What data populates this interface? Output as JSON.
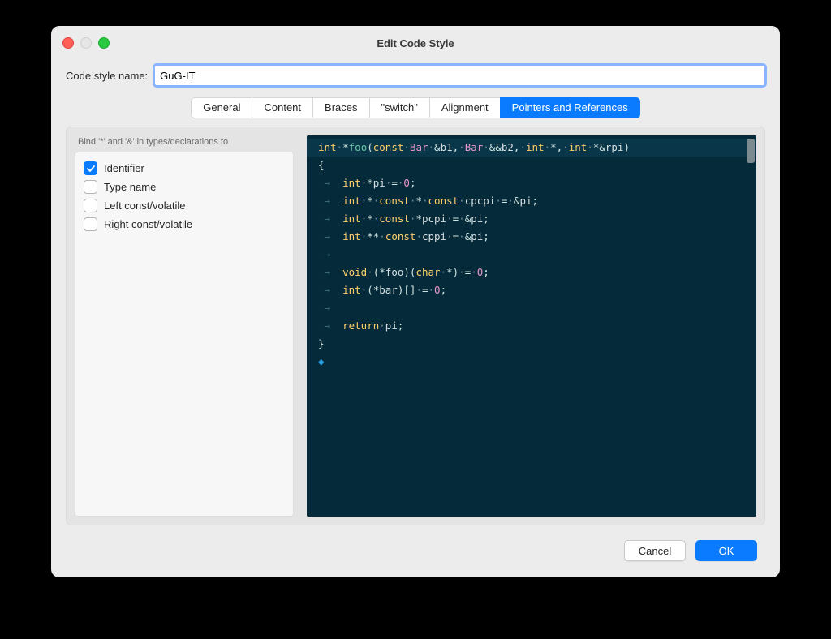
{
  "window": {
    "title": "Edit Code Style"
  },
  "nameField": {
    "label": "Code style name:",
    "value": "GuG-IT"
  },
  "tabs": [
    {
      "label": "General",
      "active": false
    },
    {
      "label": "Content",
      "active": false
    },
    {
      "label": "Braces",
      "active": false
    },
    {
      "label": "\"switch\"",
      "active": false
    },
    {
      "label": "Alignment",
      "active": false
    },
    {
      "label": "Pointers and References",
      "active": true
    }
  ],
  "group": {
    "title": "Bind '*' and '&' in types/declarations to",
    "options": [
      {
        "label": "Identifier",
        "checked": true
      },
      {
        "label": "Type name",
        "checked": false
      },
      {
        "label": "Left const/volatile",
        "checked": false
      },
      {
        "label": "Right const/volatile",
        "checked": false
      }
    ]
  },
  "buttons": {
    "cancel": "Cancel",
    "ok": "OK"
  },
  "preview": {
    "sig_prefix": "int",
    "sig_fn": "foo",
    "sig_p1_kw": "const",
    "sig_p1_t": "Bar",
    "sig_p1_n": "b1",
    "sig_p2_t": "Bar",
    "sig_p2_n": "b2",
    "sig_p3_t": "int",
    "sig_p4_t": "int",
    "sig_p4_n": "rpi",
    "l1_t": "int",
    "l1_n": "pi",
    "l1_v": "0",
    "l2_t": "int",
    "l2_k": "const",
    "l2_n": "cpcpi",
    "l2_r": "pi",
    "l3_t": "int",
    "l3_k": "const",
    "l3_n": "pcpi",
    "l3_r": "pi",
    "l4_t": "int",
    "l4_k": "const",
    "l4_n": "cppi",
    "l4_r": "pi",
    "l6_t": "void",
    "l6_n": "foo",
    "l6_a": "char",
    "l6_v": "0",
    "l7_t": "int",
    "l7_n": "bar",
    "l7_v": "0",
    "ret": "return",
    "ret_n": "pi"
  }
}
